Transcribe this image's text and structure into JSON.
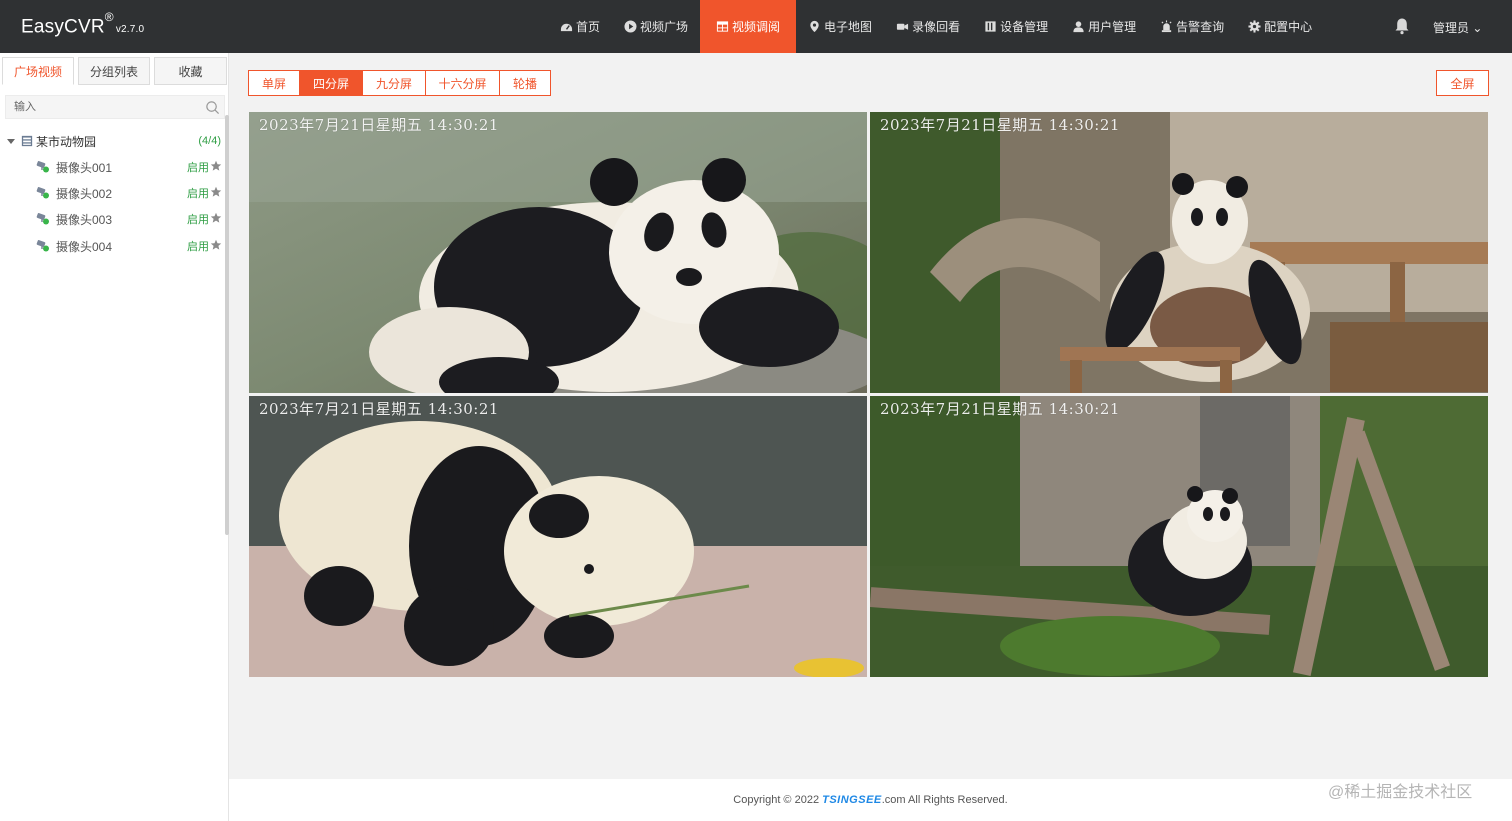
{
  "header": {
    "brand": "EasyCVR",
    "brand_mark": "®",
    "version": "v2.7.0",
    "nav": [
      {
        "label": "首页",
        "icon": "dashboard-icon"
      },
      {
        "label": "视频广场",
        "icon": "play-circle-icon"
      },
      {
        "label": "视频调阅",
        "icon": "grid-table-icon",
        "active": true
      },
      {
        "label": "电子地图",
        "icon": "map-pin-icon"
      },
      {
        "label": "录像回看",
        "icon": "video-camera-icon"
      },
      {
        "label": "设备管理",
        "icon": "device-icon"
      },
      {
        "label": "用户管理",
        "icon": "user-icon"
      },
      {
        "label": "告警查询",
        "icon": "alarm-icon"
      },
      {
        "label": "配置中心",
        "icon": "gear-icon"
      }
    ],
    "user": "管理员 ⌄"
  },
  "sidebar": {
    "tabs": [
      "广场视频",
      "分组列表",
      "收藏"
    ],
    "search_placeholder": "输入",
    "group": {
      "label": "某市动物园",
      "count": "(4/4)"
    },
    "cameras": [
      {
        "label": "摄像头001",
        "status": "启用"
      },
      {
        "label": "摄像头002",
        "status": "启用"
      },
      {
        "label": "摄像头003",
        "status": "启用"
      },
      {
        "label": "摄像头004",
        "status": "启用"
      }
    ]
  },
  "toolbar": {
    "split_modes": [
      "单屏",
      "四分屏",
      "九分屏",
      "十六分屏",
      "轮播"
    ],
    "active_mode": "四分屏",
    "fullscreen": "全屏"
  },
  "players": [
    {
      "timestamp": "2023年7月21日星期五 14:30:21"
    },
    {
      "timestamp": "2023年7月21日星期五 14:30:21"
    },
    {
      "timestamp": "2023年7月21日星期五 14:30:21"
    },
    {
      "timestamp": "2023年7月21日星期五 14:30:21"
    }
  ],
  "footer": {
    "copyright": "Copyright © 2022",
    "company": "TSINGSEE",
    "rights": ".com All Rights Reserved."
  },
  "watermark": "@稀土掘金技术社区",
  "colors": {
    "accent": "#f0552c",
    "header_bg": "#2f3133",
    "status_green": "#2f9e44"
  }
}
